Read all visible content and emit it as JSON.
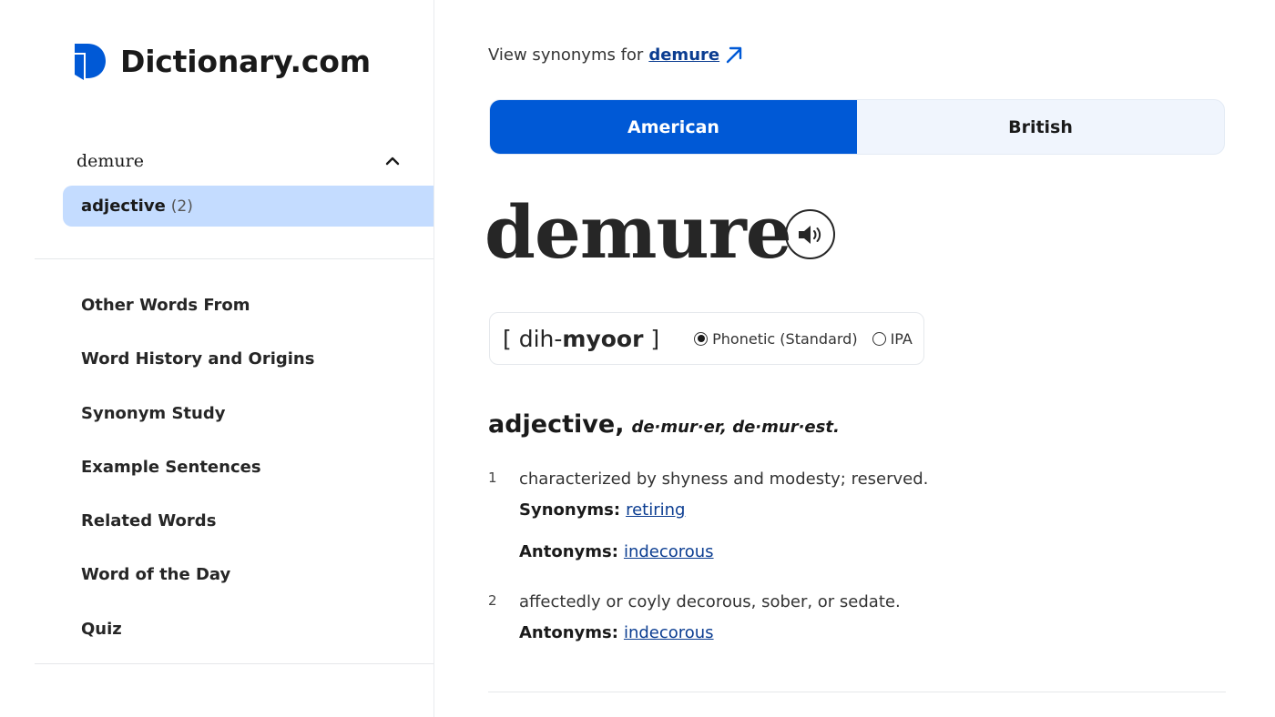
{
  "logo": {
    "text": "Dictionary.com",
    "icon": "dictionary-logo-icon"
  },
  "sidebar": {
    "entry_word": "demure",
    "pos_label": "adjective",
    "pos_count": "(2)",
    "nav": [
      {
        "label": "Other Words From"
      },
      {
        "label": "Word History and Origins"
      },
      {
        "label": "Synonym Study"
      },
      {
        "label": "Example Sentences"
      },
      {
        "label": "Related Words"
      },
      {
        "label": "Word of the Day"
      },
      {
        "label": "Quiz"
      }
    ]
  },
  "synonyms_link": {
    "prefix": "View synonyms for",
    "word": "demure",
    "icon": "arrow-up-right-icon"
  },
  "dialect_toggle": {
    "american": "American",
    "british": "British",
    "selected": "American"
  },
  "headword": "demure",
  "pronunciation": {
    "open": "[ dih-",
    "stress": "myoor",
    "close": " ]",
    "option_phonetic": "Phonetic (Standard)",
    "option_ipa": "IPA",
    "selected": "Phonetic (Standard)"
  },
  "part_of_speech": {
    "label": "adjective,",
    "inflections": "de·mur·er, de·mur·est."
  },
  "definitions": [
    {
      "number": "1",
      "text": "characterized by shyness and modesty; reserved.",
      "synonyms_label": "Synonyms:",
      "synonyms": "retiring",
      "antonyms_label": "Antonyms:",
      "antonyms": "indecorous"
    },
    {
      "number": "2",
      "text": "affectedly or coyly decorous, sober, or sedate.",
      "antonyms_label": "Antonyms:",
      "antonyms": "indecorous"
    }
  ],
  "colors": {
    "accent": "#0059d6",
    "highlight": "#c4dcff",
    "link": "#0b3d91",
    "logo": "#0059d6"
  }
}
